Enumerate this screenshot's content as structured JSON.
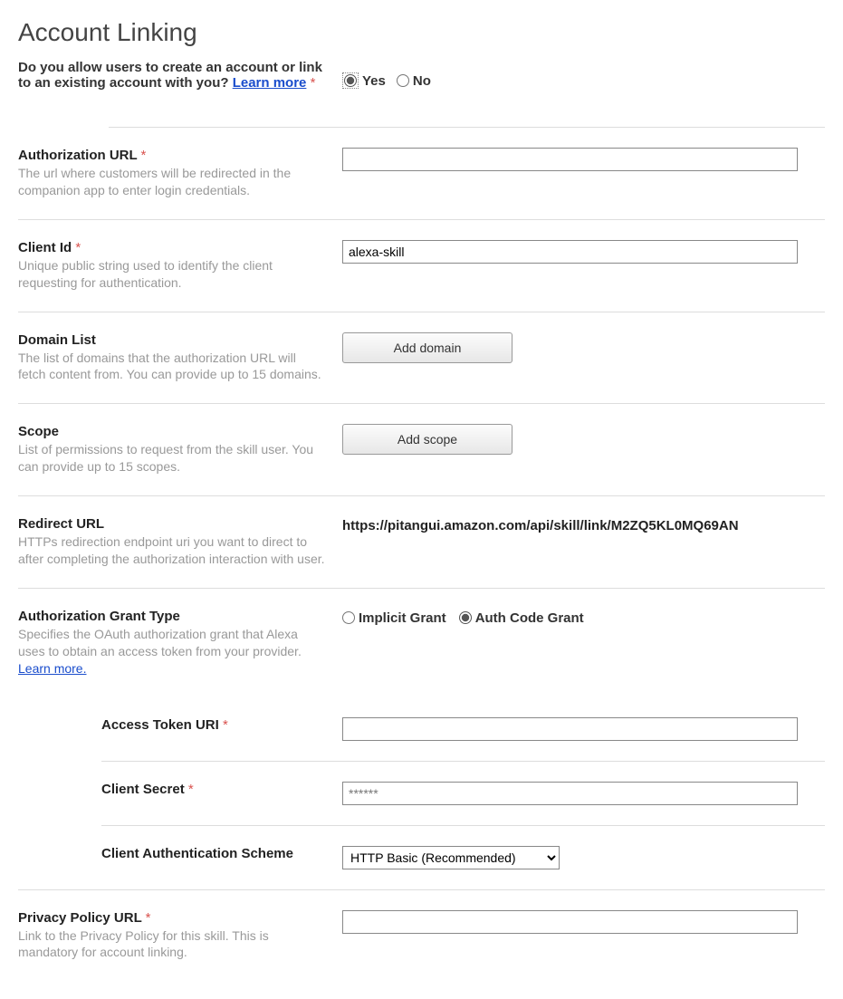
{
  "page_title": "Account Linking",
  "top_question": {
    "text": "Do you allow users to create an account or link to an existing account with you? ",
    "learn_more": "Learn more",
    "required_mark": "*",
    "yes": "Yes",
    "no": "No",
    "selected": "yes"
  },
  "fields": {
    "auth_url": {
      "label": "Authorization URL",
      "required": "*",
      "desc": "The url where customers will be redirected in the companion app to enter login credentials.",
      "value": ""
    },
    "client_id": {
      "label": "Client Id",
      "required": "*",
      "desc": "Unique public string used to identify the client requesting for authentication.",
      "value": "alexa-skill"
    },
    "domain_list": {
      "label": "Domain List",
      "desc": "The list of domains that the authorization URL will fetch content from. You can provide up to 15 domains.",
      "button": "Add domain"
    },
    "scope": {
      "label": "Scope",
      "desc": "List of permissions to request from the skill user. You can provide up to 15 scopes.",
      "button": "Add scope"
    },
    "redirect_url": {
      "label": "Redirect URL",
      "desc": "HTTPs redirection endpoint uri you want to direct to after completing the authorization interaction with user.",
      "value": "https://pitangui.amazon.com/api/skill/link/M2ZQ5KL0MQ69AN"
    },
    "grant_type": {
      "label": "Authorization Grant Type",
      "desc": "Specifies the OAuth authorization grant that Alexa uses to obtain an access token from your provider. ",
      "learn_more": "Learn more.",
      "implicit": "Implicit Grant",
      "auth_code": "Auth Code Grant",
      "selected": "auth_code"
    },
    "access_token_uri": {
      "label": "Access Token URI",
      "required": "*",
      "value": ""
    },
    "client_secret": {
      "label": "Client Secret",
      "required": "*",
      "value": "******"
    },
    "client_auth_scheme": {
      "label": "Client Authentication Scheme",
      "selected": "HTTP Basic (Recommended)"
    },
    "privacy_policy": {
      "label": "Privacy Policy URL",
      "required": "*",
      "desc": "Link to the Privacy Policy for this skill. This is mandatory for account linking.",
      "value": ""
    }
  }
}
